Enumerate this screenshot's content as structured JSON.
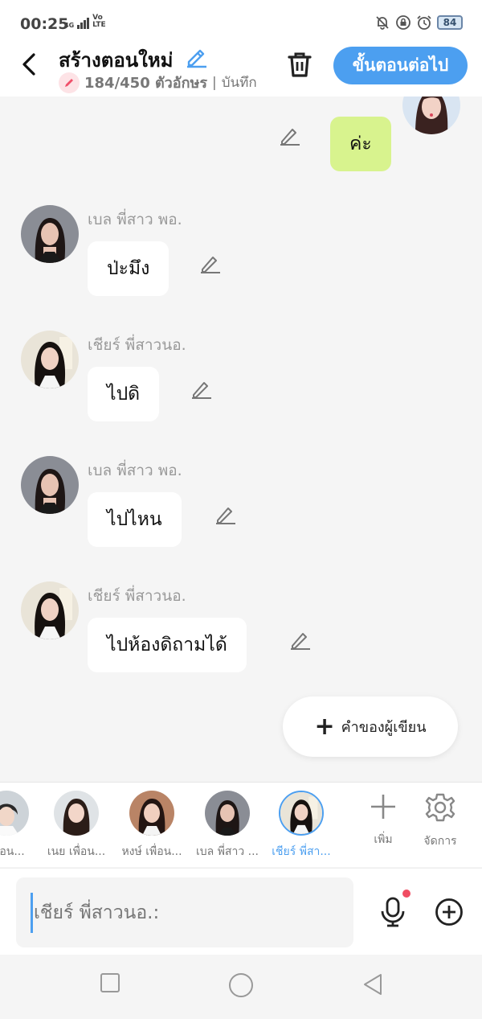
{
  "status_bar": {
    "time": "00:25",
    "network": "4G",
    "volte_top": "Vo",
    "volte_bottom": "LTE",
    "battery": "84",
    "icons": [
      "bell-off-icon",
      "lock-rotation-icon",
      "alarm-icon"
    ]
  },
  "header": {
    "title": "สร้างตอนใหม่",
    "char_count": "184/450 ตัวอักษร",
    "separator": "|",
    "save_label": "บันทึก",
    "next_label": "ขั้นตอนต่อไป"
  },
  "messages": [
    {
      "sender": "",
      "text": "ค่ะ",
      "mine": true
    },
    {
      "sender": "เบล พี่สาว พอ.",
      "text": "ป่ะมึง",
      "mine": false
    },
    {
      "sender": "เชียร์ พี่สาวนอ.",
      "text": "ไปดิ",
      "mine": false
    },
    {
      "sender": "เบล พี่สาว พอ.",
      "text": "ไปไหน",
      "mine": false
    },
    {
      "sender": "เชียร์ พี่สาวนอ.",
      "text": "ไปห้องดิถามได้",
      "mine": false
    }
  ],
  "author_words_label": "คำของผู้เขียน",
  "characters": [
    {
      "name": "เพื่อน...",
      "active": false
    },
    {
      "name": "เนย เพื่อน...",
      "active": false
    },
    {
      "name": "หงษ์ เพื่อน...",
      "active": false
    },
    {
      "name": "เบล พี่สาว ...",
      "active": false
    },
    {
      "name": "เชียร์ พี่สา...",
      "active": true
    }
  ],
  "tools": {
    "add_label": "เพิ่ม",
    "manage_label": "จัดการ"
  },
  "input": {
    "placeholder": "เชียร์ พี่สาวนอ.:"
  },
  "colors": {
    "accent": "#4c9ff0",
    "my_bubble": "#d8f38e",
    "mic_dot": "#f04d62"
  }
}
